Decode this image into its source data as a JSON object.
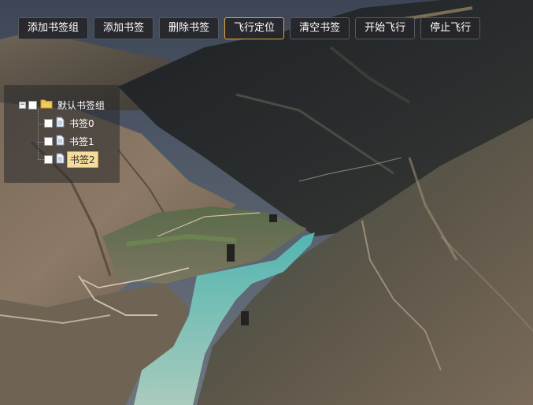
{
  "toolbar": {
    "buttons": [
      {
        "label": "添加书签组"
      },
      {
        "label": "添加书签"
      },
      {
        "label": "删除书签"
      },
      {
        "label": "飞行定位",
        "active": true
      },
      {
        "label": "清空书签"
      },
      {
        "label": "开始飞行"
      },
      {
        "label": "停止飞行"
      }
    ]
  },
  "tree": {
    "group": {
      "label": "默认书签组",
      "icon": "folder-icon",
      "expanded": true
    },
    "items": [
      {
        "label": "书签0",
        "icon": "file-icon"
      },
      {
        "label": "书签1",
        "icon": "file-icon"
      },
      {
        "label": "书签2",
        "icon": "file-icon",
        "selected": true
      }
    ]
  },
  "colors": {
    "active_border": "#e3a838",
    "selected_bg": "#f5dc9a",
    "river": "#8fc9bd"
  }
}
